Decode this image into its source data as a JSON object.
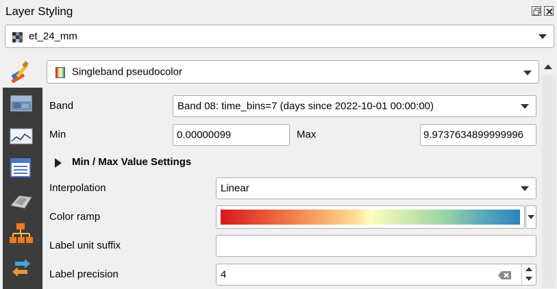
{
  "panel": {
    "title": "Layer Styling"
  },
  "layer_select": {
    "value": "et_24_mm"
  },
  "renderer_select": {
    "value": "Singleband pseudocolor"
  },
  "sidebar": {
    "icons": [
      "symbology-icon",
      "histogram-icon",
      "metadata-icon",
      "3d-view-icon",
      "layer-tree-icon",
      "history-icon"
    ]
  },
  "form": {
    "band_label": "Band",
    "band_value": "Band 08: time_bins=7 (days since 2022-10-01 00:00:00)",
    "min_label": "Min",
    "min_value": "0.00000099",
    "max_label": "Max",
    "max_value": "9.9737634899999996",
    "minmax_section": "Min / Max Value Settings",
    "interpolation_label": "Interpolation",
    "interpolation_value": "Linear",
    "color_ramp_label": "Color ramp",
    "label_unit_suffix_label": "Label unit suffix",
    "label_unit_suffix_value": "",
    "label_precision_label": "Label precision",
    "label_precision_value": "4"
  },
  "colors": {
    "ramp": [
      "#d7191c",
      "#fdae61",
      "#ffffbf",
      "#abdda4",
      "#2b83ba"
    ]
  }
}
